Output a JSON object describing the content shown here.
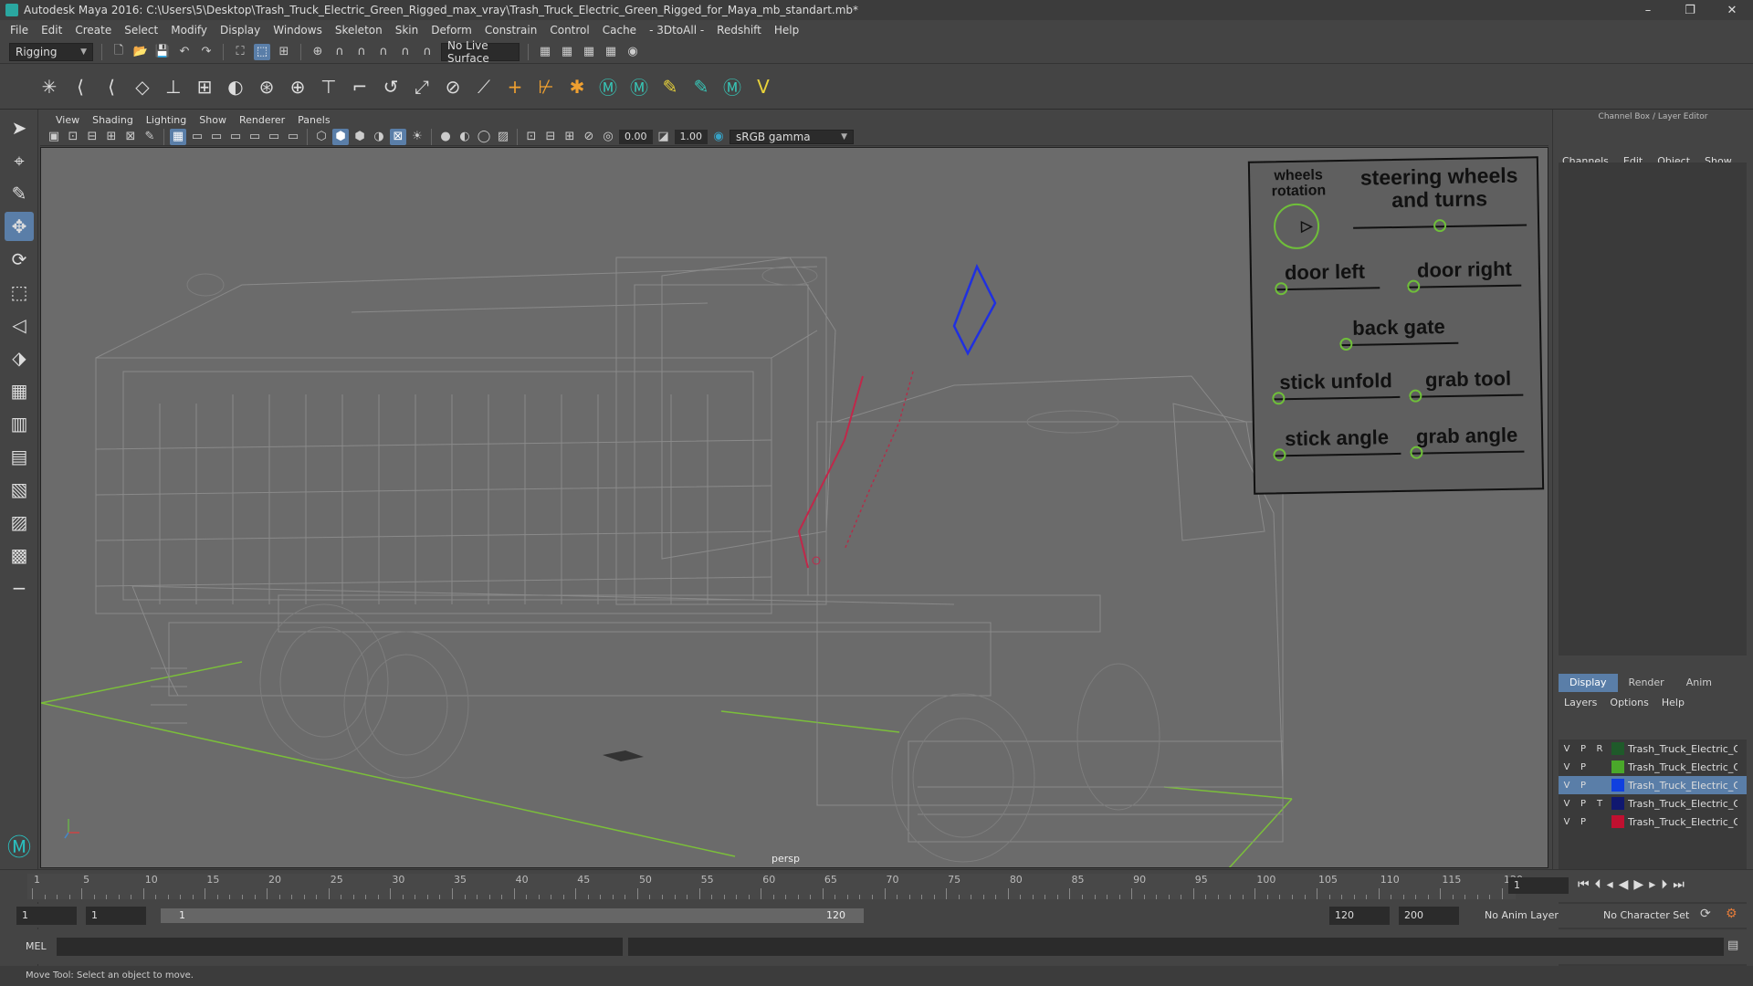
{
  "title": "Autodesk Maya 2016: C:\\Users\\5\\Desktop\\Trash_Truck_Electric_Green_Rigged_max_vray\\Trash_Truck_Electric_Green_Rigged_for_Maya_mb_standart.mb*",
  "window_controls": [
    "–",
    "❐",
    "✕"
  ],
  "menu": [
    "File",
    "Edit",
    "Create",
    "Select",
    "Modify",
    "Display",
    "Windows",
    "Skeleton",
    "Skin",
    "Deform",
    "Constrain",
    "Control",
    "Cache",
    "- 3DtoAll -",
    "Redshift",
    "Help"
  ],
  "status": {
    "mode": "Rigging",
    "live_surface": "No Live Surface"
  },
  "panel_menu": [
    "View",
    "Shading",
    "Lighting",
    "Show",
    "Renderer",
    "Panels"
  ],
  "panel_toolbar": {
    "near": "0.00",
    "gamma_val": "1.00",
    "colorspace": "sRGB gamma"
  },
  "viewport": {
    "camera": "persp",
    "controls": {
      "wheels_rotation": "wheels rotation",
      "steering": "steering wheels and turns",
      "door_left": "door left",
      "door_right": "door right",
      "back_gate": "back gate",
      "stick_unfold": "stick unfold",
      "grab_tool": "grab tool",
      "stick_angle": "stick angle",
      "grab_angle": "grab angle"
    }
  },
  "right_panel": {
    "header": "Channel Box / Layer Editor",
    "menu": [
      "Channels",
      "Edit",
      "Object",
      "Show"
    ],
    "tabs": [
      "Display",
      "Render",
      "Anim"
    ],
    "layer_menu": [
      "Layers",
      "Options",
      "Help"
    ],
    "layers": [
      {
        "v": "V",
        "p": "P",
        "r": "R",
        "name": "Trash_Truck_Electric_Green",
        "color": "#1f5a2a",
        "selected": false
      },
      {
        "v": "V",
        "p": "P",
        "r": "",
        "name": "Trash_Truck_Electric_G",
        "color": "#4aa82a",
        "selected": false
      },
      {
        "v": "V",
        "p": "P",
        "r": "",
        "name": "Trash_Truck_Electric_G",
        "color": "#1040e0",
        "selected": true
      },
      {
        "v": "V",
        "p": "P",
        "r": "T",
        "name": "Trash_Truck_Electric_G",
        "color": "#101870",
        "selected": false
      },
      {
        "v": "V",
        "p": "P",
        "r": "",
        "name": "Trash_Truck_Electric_G",
        "color": "#c01030",
        "selected": false
      }
    ]
  },
  "timeline": {
    "ticks": [
      "1",
      "5",
      "10",
      "15",
      "20",
      "25",
      "30",
      "35",
      "40",
      "45",
      "50",
      "55",
      "60",
      "65",
      "70",
      "75",
      "80",
      "85",
      "90",
      "95",
      "100",
      "105",
      "110",
      "115",
      "120"
    ],
    "current_frame": "1"
  },
  "range": {
    "start": "1",
    "anim_start": "1",
    "slider_start": "1",
    "slider_end": "120",
    "end": "120",
    "anim_end": "200",
    "anim_layer": "No Anim Layer",
    "character_set": "No Character Set"
  },
  "command": {
    "label": "MEL"
  },
  "help_text": "Move Tool: Select an object to move."
}
